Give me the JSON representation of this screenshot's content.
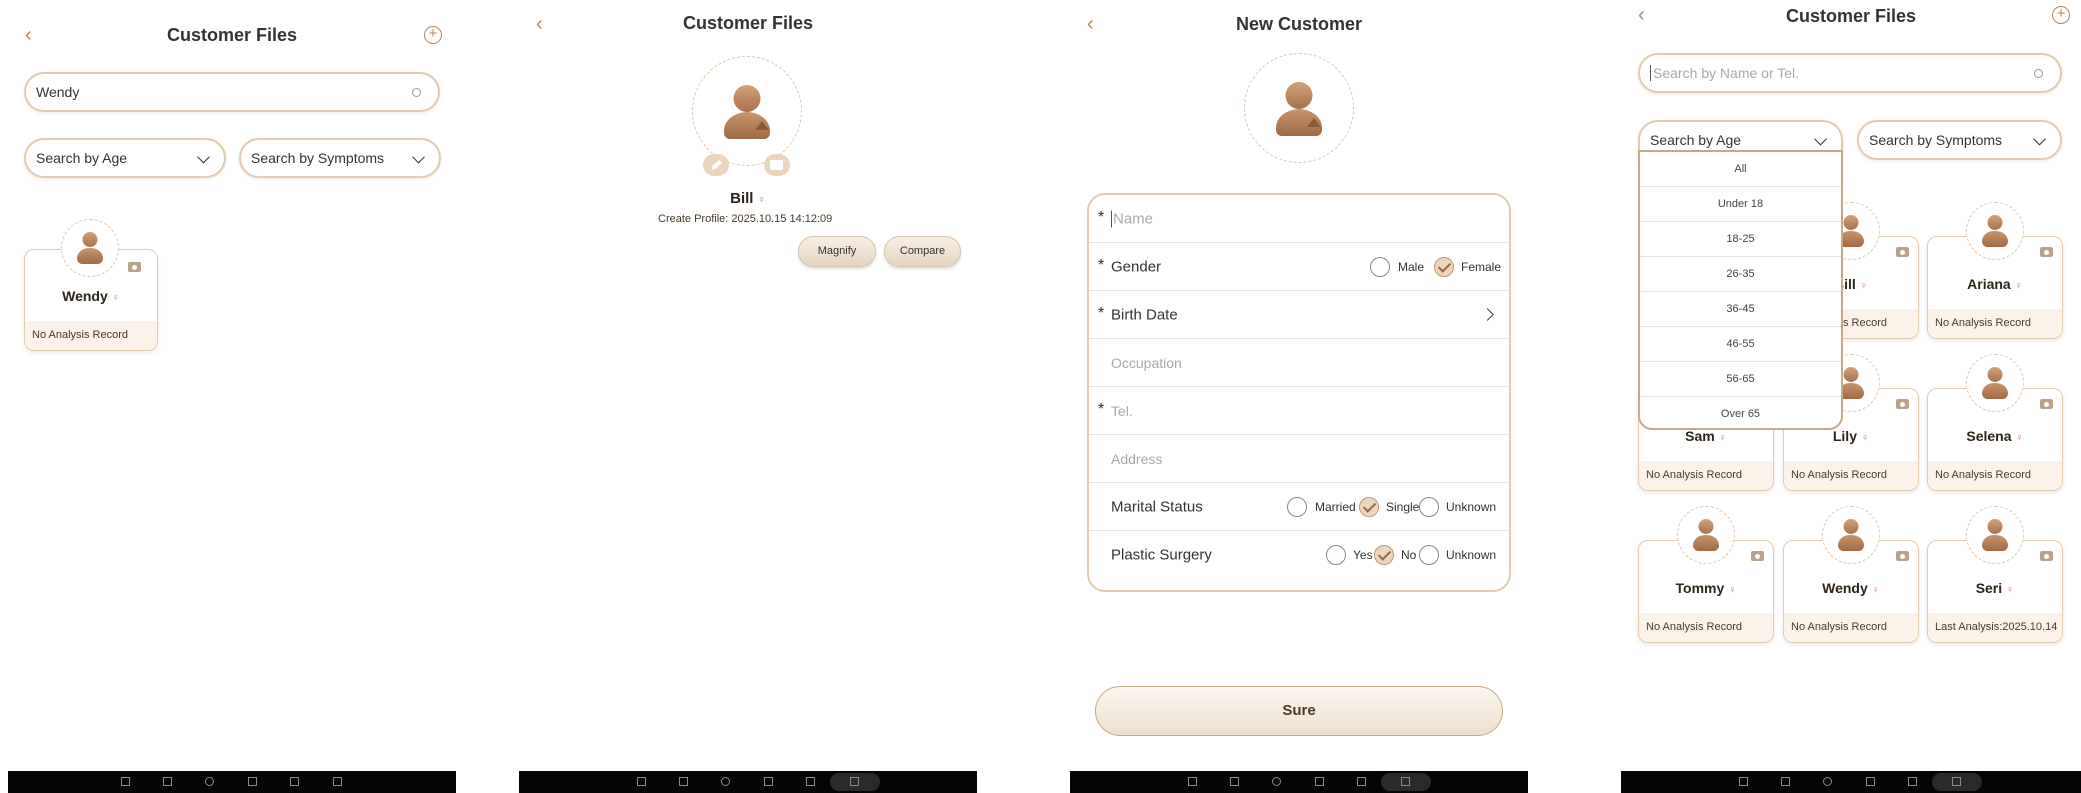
{
  "panel1": {
    "title": "Customer Files",
    "search_value": "Wendy",
    "age_filter": "Search by Age",
    "symptom_filter": "Search by Symptoms",
    "card": {
      "name": "Wendy",
      "record": "No Analysis Record"
    }
  },
  "panel2": {
    "title": "Customer Files",
    "name": "Bill",
    "create_profile": "Create Profile:  2025.10.15  14:12:09",
    "magnify": "Magnify",
    "compare": "Compare"
  },
  "panel3": {
    "title": "New Customer",
    "fields": {
      "name": "Name",
      "gender": "Gender",
      "birth_date": "Birth Date",
      "occupation": "Occupation",
      "tel": "Tel.",
      "address": "Address",
      "marital_status": "Marital Status",
      "plastic_surgery": "Plastic Surgery"
    },
    "gender_options": [
      "Male",
      "Female"
    ],
    "gender_selected": "Female",
    "marital_options": [
      "Married",
      "Single",
      "Unknown"
    ],
    "marital_selected": "Single",
    "surgery_options": [
      "Yes",
      "No",
      "Unknown"
    ],
    "surgery_selected": "No",
    "sure": "Sure",
    "required_mark": "*"
  },
  "panel4": {
    "title": "Customer Files",
    "search_placeholder": "Search by Name or Tel.",
    "age_filter": "Search by Age",
    "symptom_filter": "Search by Symptoms",
    "age_options": [
      "All",
      "Under 18",
      "18-25",
      "26-35",
      "36-45",
      "46-55",
      "56-65",
      "Over 65"
    ],
    "cards": [
      {
        "name": "Bill",
        "record": "No Analysis Record"
      },
      {
        "name": "Ariana",
        "record": "No Analysis Record"
      },
      {
        "name": "Sam",
        "record": "No Analysis Record"
      },
      {
        "name": "Lily",
        "record": "No Analysis Record"
      },
      {
        "name": "Selena",
        "record": "No Analysis Record"
      },
      {
        "name": "Tommy",
        "record": "No Analysis Record"
      },
      {
        "name": "Wendy",
        "record": "No Analysis Record"
      },
      {
        "name": "Seri",
        "record": "Last Analysis:2025.10.14"
      }
    ]
  },
  "icons": {
    "back": "chevron-left-icon",
    "add": "plus-circle-icon",
    "search": "search-icon",
    "female": "female-icon",
    "camera": "camera-icon",
    "edit": "pencil-icon",
    "upload": "upload-arrow-icon"
  },
  "colors": {
    "accent": "#b8875a",
    "border": "#e2ccb0",
    "record_bg": "#fbf3ea",
    "female": "#e07a88"
  }
}
